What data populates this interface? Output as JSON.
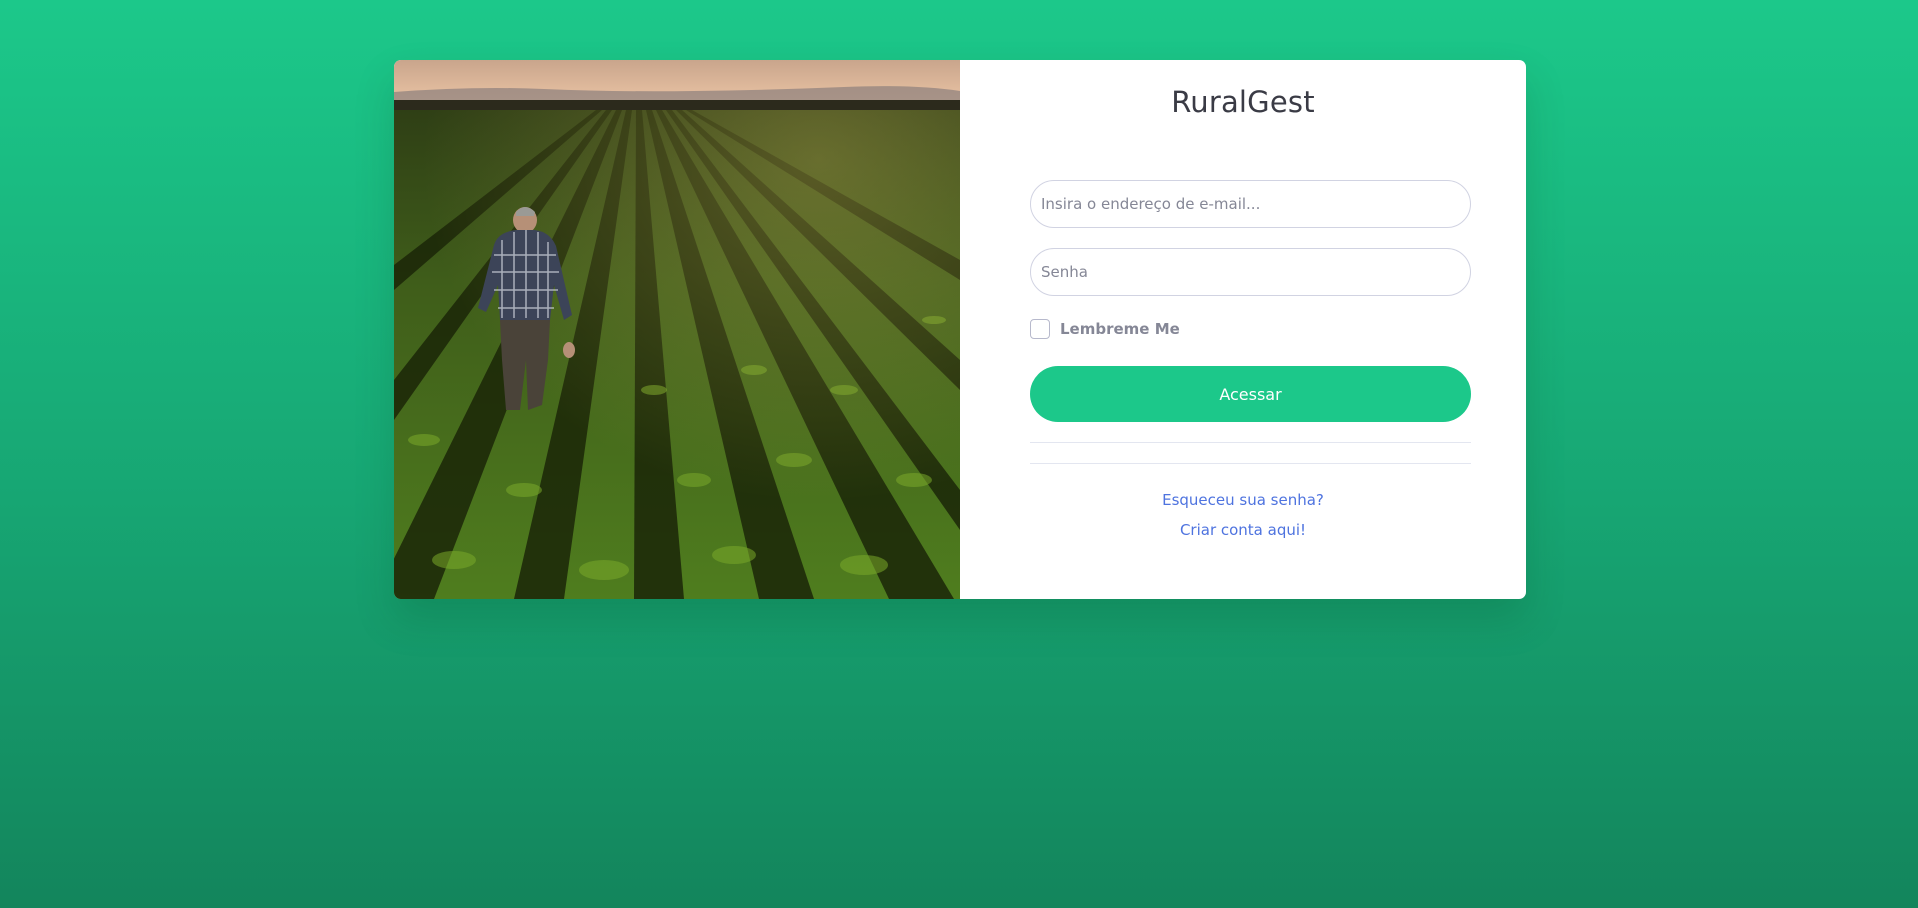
{
  "brand": {
    "title": "RuralGest"
  },
  "hero_image": {
    "subject": "farmer walking in crop field"
  },
  "form": {
    "email_placeholder": "Insira o endereço de e-mail...",
    "email_value": "",
    "password_placeholder": "Senha",
    "password_value": "",
    "remember_label": "Lembreme Me",
    "remember_checked": false,
    "submit_label": "Acessar"
  },
  "links": {
    "forgot_password": "Esqueceu sua senha?",
    "create_account": "Criar conta aqui!"
  },
  "colors": {
    "primary": "#1cc88a",
    "link": "#4e73df",
    "background_top": "#1cc88a",
    "background_bottom": "#13855c"
  }
}
